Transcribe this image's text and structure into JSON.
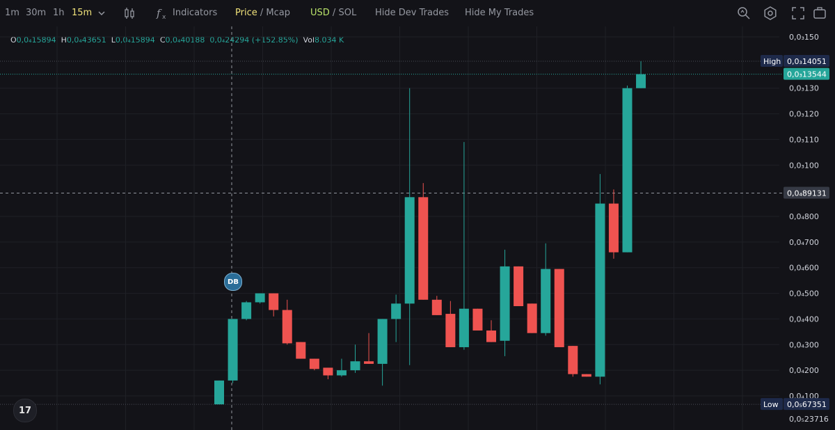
{
  "toolbar": {
    "timeframes": [
      "1m",
      "30m",
      "1h",
      "15m"
    ],
    "active_timeframe": "15m",
    "indicators_label": "Indicators",
    "price_label": "Price",
    "separator": "/",
    "mcap_label": "Mcap",
    "usd_label": "USD",
    "sol_label": "SOL",
    "hide_dev_label": "Hide Dev Trades",
    "hide_my_label": "Hide My Trades"
  },
  "ohlc": {
    "o_key": "O",
    "o_val": "0,0₄15894",
    "h_key": "H",
    "h_val": "0,0₄43651",
    "l_key": "L",
    "l_val": "0,0₄15894",
    "c_key": "C",
    "c_val": "0,0₄40188",
    "change": "0,0₄24294 (+152.85%)",
    "vol_key": "Vol",
    "vol_val": "8.034 K"
  },
  "badges": {
    "logo": "17",
    "marker": "DB"
  },
  "colors": {
    "background": "#131318",
    "up": "#26a69a",
    "down": "#ef5350",
    "grid": "#1f2026",
    "text": "#d1d4dc"
  },
  "chart_data": {
    "type": "candlestick",
    "x_unit": "15m bars",
    "y_ticks": [
      {
        "value": 0.00015,
        "label": "0,0₃150"
      },
      {
        "value": 0.00013,
        "label": "0,0₃130"
      },
      {
        "value": 0.00012,
        "label": "0,0₃120"
      },
      {
        "value": 0.00011,
        "label": "0,0₃110"
      },
      {
        "value": 0.0001,
        "label": "0,0₃100"
      },
      {
        "value": 8e-05,
        "label": "0,0₄800"
      },
      {
        "value": 7e-05,
        "label": "0,0₄700"
      },
      {
        "value": 6e-05,
        "label": "0,0₄600"
      },
      {
        "value": 5e-05,
        "label": "0,0₄500"
      },
      {
        "value": 4e-05,
        "label": "0,0₄400"
      },
      {
        "value": 3e-05,
        "label": "0,0₄300"
      },
      {
        "value": 2e-05,
        "label": "0,0₄200"
      },
      {
        "value": 1e-05,
        "label": "0,0₄100"
      },
      {
        "value": 1e-06,
        "label": "0,0₅23716"
      }
    ],
    "markers": [
      {
        "label": "High",
        "value": 0.00014051,
        "text": "0,0₃14051",
        "style": "extreme"
      },
      {
        "value": 0.00013544,
        "text": "0,0₃13544",
        "style": "last"
      },
      {
        "value": 8.91e-05,
        "text": "0,0₄89131",
        "style": "crosshair"
      },
      {
        "label": "Low",
        "value": 6.7e-06,
        "text": "0,0₅67351",
        "style": "extreme"
      }
    ],
    "candles": [
      {
        "o": 6.7e-06,
        "h": 1.6e-05,
        "l": 6.7e-06,
        "c": 1.6e-05
      },
      {
        "o": 1.6e-05,
        "h": 4e-05,
        "l": 1.5e-05,
        "c": 4e-05
      },
      {
        "o": 4e-05,
        "h": 4.7e-05,
        "l": 3.95e-05,
        "c": 4.65e-05
      },
      {
        "o": 4.65e-05,
        "h": 5e-05,
        "l": 4.6e-05,
        "c": 5e-05
      },
      {
        "o": 5e-05,
        "h": 5e-05,
        "l": 4.1e-05,
        "c": 4.35e-05
      },
      {
        "o": 4.35e-05,
        "h": 4.75e-05,
        "l": 3e-05,
        "c": 3.05e-05
      },
      {
        "o": 3.1e-05,
        "h": 3.1e-05,
        "l": 2.45e-05,
        "c": 2.45e-05
      },
      {
        "o": 2.45e-05,
        "h": 2.45e-05,
        "l": 2e-05,
        "c": 2.05e-05
      },
      {
        "o": 2.1e-05,
        "h": 2.1e-05,
        "l": 1.65e-05,
        "c": 1.8e-05
      },
      {
        "o": 1.8e-05,
        "h": 2.45e-05,
        "l": 1.75e-05,
        "c": 2e-05
      },
      {
        "o": 2e-05,
        "h": 3e-05,
        "l": 1.9e-05,
        "c": 2.35e-05
      },
      {
        "o": 2.35e-05,
        "h": 3.45e-05,
        "l": 2.25e-05,
        "c": 2.25e-05
      },
      {
        "o": 2.25e-05,
        "h": 4e-05,
        "l": 1.4e-05,
        "c": 4e-05
      },
      {
        "o": 4e-05,
        "h": 4.95e-05,
        "l": 3.1e-05,
        "c": 4.6e-05
      },
      {
        "o": 4.6e-05,
        "h": 0.00013,
        "l": 2.2e-05,
        "c": 8.75e-05
      },
      {
        "o": 8.75e-05,
        "h": 9.3e-05,
        "l": 4.75e-05,
        "c": 4.75e-05
      },
      {
        "o": 4.75e-05,
        "h": 4.9e-05,
        "l": 4.15e-05,
        "c": 4.15e-05
      },
      {
        "o": 4.2e-05,
        "h": 4.7e-05,
        "l": 2.9e-05,
        "c": 2.9e-05
      },
      {
        "o": 2.9e-05,
        "h": 0.000109,
        "l": 2.8e-05,
        "c": 4.4e-05
      },
      {
        "o": 4.4e-05,
        "h": 4.4e-05,
        "l": 3.55e-05,
        "c": 3.55e-05
      },
      {
        "o": 3.55e-05,
        "h": 3.95e-05,
        "l": 3.1e-05,
        "c": 3.1e-05
      },
      {
        "o": 3.15e-05,
        "h": 6.7e-05,
        "l": 2.55e-05,
        "c": 6.05e-05
      },
      {
        "o": 6.05e-05,
        "h": 6.05e-05,
        "l": 4.5e-05,
        "c": 4.5e-05
      },
      {
        "o": 4.6e-05,
        "h": 4.6e-05,
        "l": 3.45e-05,
        "c": 3.45e-05
      },
      {
        "o": 3.45e-05,
        "h": 6.95e-05,
        "l": 3.35e-05,
        "c": 5.95e-05
      },
      {
        "o": 5.95e-05,
        "h": 5.95e-05,
        "l": 2.9e-05,
        "c": 2.9e-05
      },
      {
        "o": 2.95e-05,
        "h": 2.95e-05,
        "l": 1.75e-05,
        "c": 1.85e-05
      },
      {
        "o": 1.85e-05,
        "h": 1.85e-05,
        "l": 1.75e-05,
        "c": 1.75e-05
      },
      {
        "o": 1.75e-05,
        "h": 9.65e-05,
        "l": 1.45e-05,
        "c": 8.5e-05
      },
      {
        "o": 8.5e-05,
        "h": 9.05e-05,
        "l": 6.35e-05,
        "c": 6.6e-05
      },
      {
        "o": 6.6e-05,
        "h": 0.000131,
        "l": 6.6e-05,
        "c": 0.00013
      },
      {
        "o": 0.00013,
        "h": 0.0001405,
        "l": 0.00013,
        "c": 0.00013544
      }
    ]
  }
}
